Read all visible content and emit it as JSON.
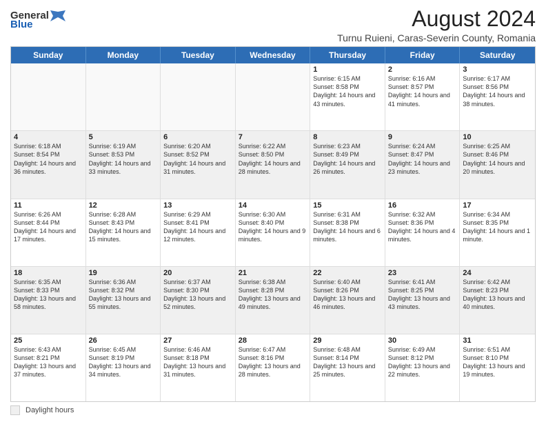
{
  "header": {
    "logo_general": "General",
    "logo_blue": "Blue",
    "main_title": "August 2024",
    "subtitle": "Turnu Ruieni, Caras-Severin County, Romania"
  },
  "days_of_week": [
    "Sunday",
    "Monday",
    "Tuesday",
    "Wednesday",
    "Thursday",
    "Friday",
    "Saturday"
  ],
  "weeks": [
    [
      {
        "day": "",
        "text": ""
      },
      {
        "day": "",
        "text": ""
      },
      {
        "day": "",
        "text": ""
      },
      {
        "day": "",
        "text": ""
      },
      {
        "day": "1",
        "text": "Sunrise: 6:15 AM\nSunset: 8:58 PM\nDaylight: 14 hours and 43 minutes."
      },
      {
        "day": "2",
        "text": "Sunrise: 6:16 AM\nSunset: 8:57 PM\nDaylight: 14 hours and 41 minutes."
      },
      {
        "day": "3",
        "text": "Sunrise: 6:17 AM\nSunset: 8:56 PM\nDaylight: 14 hours and 38 minutes."
      }
    ],
    [
      {
        "day": "4",
        "text": "Sunrise: 6:18 AM\nSunset: 8:54 PM\nDaylight: 14 hours and 36 minutes."
      },
      {
        "day": "5",
        "text": "Sunrise: 6:19 AM\nSunset: 8:53 PM\nDaylight: 14 hours and 33 minutes."
      },
      {
        "day": "6",
        "text": "Sunrise: 6:20 AM\nSunset: 8:52 PM\nDaylight: 14 hours and 31 minutes."
      },
      {
        "day": "7",
        "text": "Sunrise: 6:22 AM\nSunset: 8:50 PM\nDaylight: 14 hours and 28 minutes."
      },
      {
        "day": "8",
        "text": "Sunrise: 6:23 AM\nSunset: 8:49 PM\nDaylight: 14 hours and 26 minutes."
      },
      {
        "day": "9",
        "text": "Sunrise: 6:24 AM\nSunset: 8:47 PM\nDaylight: 14 hours and 23 minutes."
      },
      {
        "day": "10",
        "text": "Sunrise: 6:25 AM\nSunset: 8:46 PM\nDaylight: 14 hours and 20 minutes."
      }
    ],
    [
      {
        "day": "11",
        "text": "Sunrise: 6:26 AM\nSunset: 8:44 PM\nDaylight: 14 hours and 17 minutes."
      },
      {
        "day": "12",
        "text": "Sunrise: 6:28 AM\nSunset: 8:43 PM\nDaylight: 14 hours and 15 minutes."
      },
      {
        "day": "13",
        "text": "Sunrise: 6:29 AM\nSunset: 8:41 PM\nDaylight: 14 hours and 12 minutes."
      },
      {
        "day": "14",
        "text": "Sunrise: 6:30 AM\nSunset: 8:40 PM\nDaylight: 14 hours and 9 minutes."
      },
      {
        "day": "15",
        "text": "Sunrise: 6:31 AM\nSunset: 8:38 PM\nDaylight: 14 hours and 6 minutes."
      },
      {
        "day": "16",
        "text": "Sunrise: 6:32 AM\nSunset: 8:36 PM\nDaylight: 14 hours and 4 minutes."
      },
      {
        "day": "17",
        "text": "Sunrise: 6:34 AM\nSunset: 8:35 PM\nDaylight: 14 hours and 1 minute."
      }
    ],
    [
      {
        "day": "18",
        "text": "Sunrise: 6:35 AM\nSunset: 8:33 PM\nDaylight: 13 hours and 58 minutes."
      },
      {
        "day": "19",
        "text": "Sunrise: 6:36 AM\nSunset: 8:32 PM\nDaylight: 13 hours and 55 minutes."
      },
      {
        "day": "20",
        "text": "Sunrise: 6:37 AM\nSunset: 8:30 PM\nDaylight: 13 hours and 52 minutes."
      },
      {
        "day": "21",
        "text": "Sunrise: 6:38 AM\nSunset: 8:28 PM\nDaylight: 13 hours and 49 minutes."
      },
      {
        "day": "22",
        "text": "Sunrise: 6:40 AM\nSunset: 8:26 PM\nDaylight: 13 hours and 46 minutes."
      },
      {
        "day": "23",
        "text": "Sunrise: 6:41 AM\nSunset: 8:25 PM\nDaylight: 13 hours and 43 minutes."
      },
      {
        "day": "24",
        "text": "Sunrise: 6:42 AM\nSunset: 8:23 PM\nDaylight: 13 hours and 40 minutes."
      }
    ],
    [
      {
        "day": "25",
        "text": "Sunrise: 6:43 AM\nSunset: 8:21 PM\nDaylight: 13 hours and 37 minutes."
      },
      {
        "day": "26",
        "text": "Sunrise: 6:45 AM\nSunset: 8:19 PM\nDaylight: 13 hours and 34 minutes."
      },
      {
        "day": "27",
        "text": "Sunrise: 6:46 AM\nSunset: 8:18 PM\nDaylight: 13 hours and 31 minutes."
      },
      {
        "day": "28",
        "text": "Sunrise: 6:47 AM\nSunset: 8:16 PM\nDaylight: 13 hours and 28 minutes."
      },
      {
        "day": "29",
        "text": "Sunrise: 6:48 AM\nSunset: 8:14 PM\nDaylight: 13 hours and 25 minutes."
      },
      {
        "day": "30",
        "text": "Sunrise: 6:49 AM\nSunset: 8:12 PM\nDaylight: 13 hours and 22 minutes."
      },
      {
        "day": "31",
        "text": "Sunrise: 6:51 AM\nSunset: 8:10 PM\nDaylight: 13 hours and 19 minutes."
      }
    ]
  ],
  "footer": {
    "legend_label": "Daylight hours"
  }
}
